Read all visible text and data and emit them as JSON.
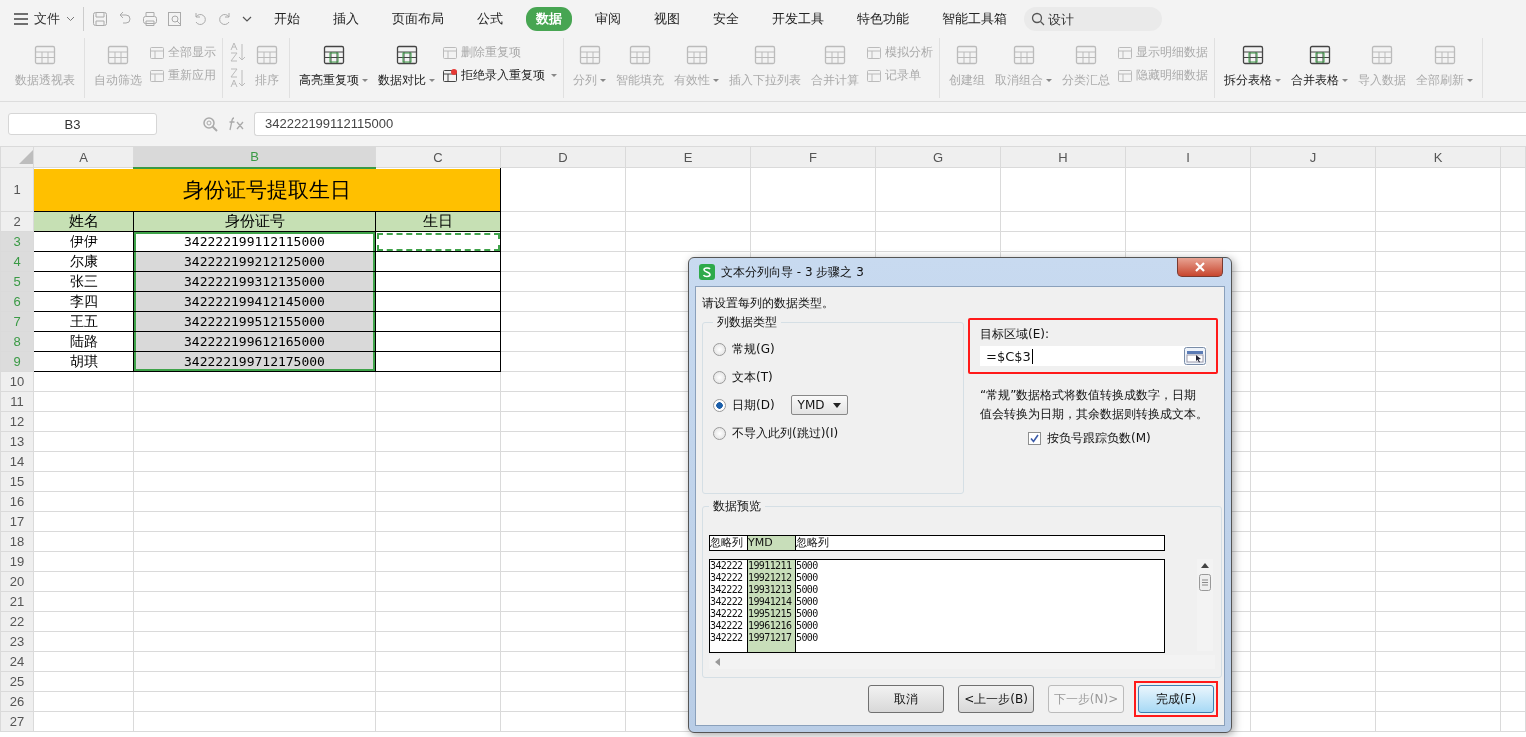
{
  "menu": {
    "file_label": "文件",
    "tabs": [
      {
        "label": "开始",
        "selected": false
      },
      {
        "label": "插入",
        "selected": false
      },
      {
        "label": "页面布局",
        "selected": false
      },
      {
        "label": "公式",
        "selected": false
      },
      {
        "label": "数据",
        "selected": true
      },
      {
        "label": "审阅",
        "selected": false
      },
      {
        "label": "视图",
        "selected": false
      },
      {
        "label": "安全",
        "selected": false
      },
      {
        "label": "开发工具",
        "selected": false
      },
      {
        "label": "特色功能",
        "selected": false
      },
      {
        "label": "智能工具箱",
        "selected": false
      }
    ],
    "search": {
      "placeholder": "设计"
    }
  },
  "ribbon": {
    "groups": [
      {
        "items": [
          {
            "kind": "large",
            "label": "数据透视表",
            "disabled": true,
            "dropdown": false
          }
        ]
      },
      {
        "items": [
          {
            "kind": "large",
            "label": "自动筛选",
            "disabled": true,
            "dropdown": false
          },
          {
            "kind": "stack",
            "items": [
              {
                "label": "全部显示",
                "disabled": true,
                "dropdown": false
              },
              {
                "label": "重新应用",
                "disabled": true,
                "dropdown": false
              }
            ]
          }
        ]
      },
      {
        "items": [
          {
            "kind": "sort",
            "label": "排序",
            "disabled": true,
            "dropdown": false
          }
        ]
      },
      {
        "items": [
          {
            "kind": "large",
            "label": "高亮重复项",
            "disabled": false,
            "dropdown": true
          },
          {
            "kind": "large",
            "label": "数据对比",
            "disabled": false,
            "dropdown": true
          },
          {
            "kind": "stack",
            "items": [
              {
                "label": "删除重复项",
                "disabled": true,
                "dropdown": false
              },
              {
                "label": "拒绝录入重复项",
                "disabled": false,
                "dropdown": true
              }
            ]
          }
        ]
      },
      {
        "items": [
          {
            "kind": "large",
            "label": "分列",
            "disabled": true,
            "dropdown": true
          },
          {
            "kind": "large",
            "label": "智能填充",
            "disabled": true,
            "dropdown": false
          },
          {
            "kind": "large",
            "label": "有效性",
            "disabled": true,
            "dropdown": true
          },
          {
            "kind": "large",
            "label": "插入下拉列表",
            "disabled": true,
            "dropdown": false
          },
          {
            "kind": "large",
            "label": "合并计算",
            "disabled": true,
            "dropdown": false
          },
          {
            "kind": "stack",
            "items": [
              {
                "label": "模拟分析",
                "disabled": true,
                "dropdown": false
              },
              {
                "label": "记录单",
                "disabled": true,
                "dropdown": false
              }
            ]
          }
        ]
      },
      {
        "items": [
          {
            "kind": "large",
            "label": "创建组",
            "disabled": true,
            "dropdown": false
          },
          {
            "kind": "large",
            "label": "取消组合",
            "disabled": true,
            "dropdown": true
          },
          {
            "kind": "large",
            "label": "分类汇总",
            "disabled": true,
            "dropdown": false
          },
          {
            "kind": "stack",
            "items": [
              {
                "label": "显示明细数据",
                "disabled": true,
                "dropdown": false
              },
              {
                "label": "隐藏明细数据",
                "disabled": true,
                "dropdown": false
              }
            ]
          }
        ]
      },
      {
        "items": [
          {
            "kind": "large",
            "label": "拆分表格",
            "disabled": false,
            "dropdown": true
          },
          {
            "kind": "large",
            "label": "合并表格",
            "disabled": false,
            "dropdown": true
          },
          {
            "kind": "large",
            "label": "导入数据",
            "disabled": true,
            "dropdown": false
          },
          {
            "kind": "large",
            "label": "全部刷新",
            "disabled": true,
            "dropdown": true
          }
        ]
      }
    ]
  },
  "formula_bar": {
    "cell_ref": "B3",
    "formula": "342222199112115000"
  },
  "sheet": {
    "columns": [
      {
        "label": "A",
        "selected": false
      },
      {
        "label": "B",
        "selected": true
      },
      {
        "label": "C",
        "selected": false
      },
      {
        "label": "D",
        "selected": false
      },
      {
        "label": "E",
        "selected": false
      },
      {
        "label": "F",
        "selected": false
      },
      {
        "label": "G",
        "selected": false
      },
      {
        "label": "H",
        "selected": false
      },
      {
        "label": "I",
        "selected": false
      },
      {
        "label": "J",
        "selected": false
      },
      {
        "label": "K",
        "selected": false
      }
    ],
    "rows": [
      {
        "number": "1",
        "selected": false,
        "kind": "title",
        "cells": [
          "身份证号提取生日"
        ]
      },
      {
        "number": "2",
        "selected": false,
        "kind": "header",
        "cells": [
          "姓名",
          "身份证号",
          "生日"
        ]
      },
      {
        "number": "3",
        "selected": true,
        "kind": "data",
        "active": true,
        "marquee": true,
        "cells": [
          "伊伊",
          "342222199112115000"
        ]
      },
      {
        "number": "4",
        "selected": true,
        "kind": "data",
        "active": false,
        "marquee": false,
        "cells": [
          "尔康",
          "342222199212125000"
        ]
      },
      {
        "number": "5",
        "selected": true,
        "kind": "data",
        "active": false,
        "marquee": false,
        "cells": [
          "张三",
          "342222199312135000"
        ]
      },
      {
        "number": "6",
        "selected": true,
        "kind": "data",
        "active": false,
        "marquee": false,
        "cells": [
          "李四",
          "342222199412145000"
        ]
      },
      {
        "number": "7",
        "selected": true,
        "kind": "data",
        "active": false,
        "marquee": false,
        "cells": [
          "王五",
          "342222199512155000"
        ]
      },
      {
        "number": "8",
        "selected": true,
        "kind": "data",
        "active": false,
        "marquee": false,
        "cells": [
          "陆路",
          "342222199612165000"
        ]
      },
      {
        "number": "9",
        "selected": true,
        "kind": "data",
        "active": false,
        "marquee": false,
        "cells": [
          "胡琪",
          "342222199712175000"
        ]
      },
      {
        "number": "10",
        "selected": false,
        "kind": "empty"
      },
      {
        "number": "11",
        "selected": false,
        "kind": "empty"
      },
      {
        "number": "12",
        "selected": false,
        "kind": "empty"
      },
      {
        "number": "13",
        "selected": false,
        "kind": "empty"
      },
      {
        "number": "14",
        "selected": false,
        "kind": "empty"
      },
      {
        "number": "15",
        "selected": false,
        "kind": "empty"
      },
      {
        "number": "16",
        "selected": false,
        "kind": "empty"
      },
      {
        "number": "17",
        "selected": false,
        "kind": "empty"
      },
      {
        "number": "18",
        "selected": false,
        "kind": "empty"
      },
      {
        "number": "19",
        "selected": false,
        "kind": "empty"
      },
      {
        "number": "20",
        "selected": false,
        "kind": "empty"
      },
      {
        "number": "21",
        "selected": false,
        "kind": "empty"
      },
      {
        "number": "22",
        "selected": false,
        "kind": "empty"
      },
      {
        "number": "23",
        "selected": false,
        "kind": "empty"
      },
      {
        "number": "24",
        "selected": false,
        "kind": "empty"
      },
      {
        "number": "25",
        "selected": false,
        "kind": "empty"
      },
      {
        "number": "26",
        "selected": false,
        "kind": "empty"
      },
      {
        "number": "27",
        "selected": false,
        "kind": "empty"
      }
    ]
  },
  "dialog": {
    "title": "文本分列向导 - 3 步骤之 3",
    "instruction": "请设置每列的数据类型。",
    "column_type": {
      "legend": "列数据类型",
      "options": [
        {
          "label": "常规(G)",
          "selected": false
        },
        {
          "label": "文本(T)",
          "selected": false
        },
        {
          "label": "日期(D)",
          "selected": true,
          "format": "YMD"
        },
        {
          "label": "不导入此列(跳过)(I)",
          "selected": false
        }
      ]
    },
    "target": {
      "label": "目标区域(E):",
      "value": "=$C$3",
      "highlighted": true
    },
    "description": "“常规”数据格式将数值转换成数字，日期值会转换为日期，其余数据则转换成文本。",
    "negative_checkbox": {
      "label": "按负号跟踪负数(M)",
      "checked": true
    },
    "preview": {
      "legend": "数据预览",
      "columns": [
        {
          "label": "忽略列",
          "selected": false
        },
        {
          "label": "YMD",
          "selected": true
        },
        {
          "label": "忽略列",
          "selected": false
        }
      ],
      "rows": [
        [
          "342222",
          "19911211",
          "5000"
        ],
        [
          "342222",
          "19921212",
          "5000"
        ],
        [
          "342222",
          "19931213",
          "5000"
        ],
        [
          "342222",
          "19941214",
          "5000"
        ],
        [
          "342222",
          "19951215",
          "5000"
        ],
        [
          "342222",
          "19961216",
          "5000"
        ],
        [
          "342222",
          "19971217",
          "5000"
        ]
      ]
    },
    "buttons": [
      {
        "label": "取消",
        "disabled": false,
        "highlighted": false
      },
      {
        "label": "<上一步(B)",
        "disabled": false,
        "highlighted": false
      },
      {
        "label": "下一步(N)>",
        "disabled": true,
        "highlighted": false
      },
      {
        "label": "完成(F)",
        "disabled": false,
        "highlighted": true
      }
    ]
  }
}
